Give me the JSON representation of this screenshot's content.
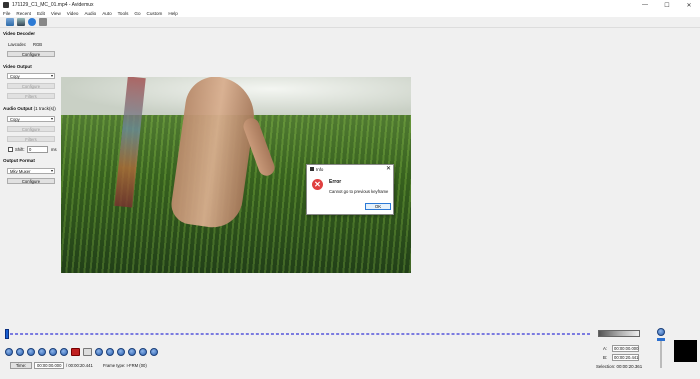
{
  "window": {
    "title": "171129_C1_MC_01.mp4 - Avidemux",
    "controls": [
      "—",
      "☐",
      "✕"
    ]
  },
  "menu": [
    "File",
    "Recent",
    "Edit",
    "View",
    "Video",
    "Audio",
    "Auto",
    "Tools",
    "Go",
    "Custom",
    "Help"
  ],
  "toolbar": {
    "icons": [
      "open-icon",
      "save-icon",
      "info-icon",
      "calculator-icon"
    ]
  },
  "left_panel": {
    "video_decoder": {
      "heading": "Video Decoder",
      "lavcodec_label": "Lavcodec",
      "lavcodec_value": "RGB",
      "configure": "Configure"
    },
    "video_output": {
      "heading": "Video Output",
      "codec": "Copy",
      "configure": "Configure",
      "filters": "Filters"
    },
    "audio_output": {
      "heading": "Audio Output",
      "tracks": "(1 track(s))",
      "codec": "Copy",
      "configure": "Configure",
      "filters": "Filters",
      "shift_label": "Shift:",
      "shift_value": "0",
      "shift_unit": "ms"
    },
    "output_format": {
      "heading": "Output Format",
      "muxer": "Mkv Muxer",
      "configure": "Configure"
    }
  },
  "dialog": {
    "title": "Info",
    "close": "✕",
    "error_icon_glyph": "✕",
    "heading": "Error",
    "message": "Cannot go to previous keyframe",
    "ok": "OK"
  },
  "status": {
    "time_button": "Time:",
    "current_time": "00:00:00.000",
    "total_time": "/ 00:00:20.441",
    "frame_type": "Frame type:  I-FRM (00)"
  },
  "ab": {
    "a_label": "A:",
    "a_value": "00:00:00.000",
    "b_label": "B:",
    "b_value": "00:00:20.441",
    "selection": "Selection: 00:00:20.361"
  },
  "playback_controls": [
    "play",
    "rewind",
    "fast-forward",
    "prev-keyframe",
    "next-keyframe",
    "set-marker-a",
    "set-marker-b",
    "prev-black",
    "next-black",
    "first-frame",
    "last-frame",
    "prev-frame",
    "next-frame"
  ]
}
